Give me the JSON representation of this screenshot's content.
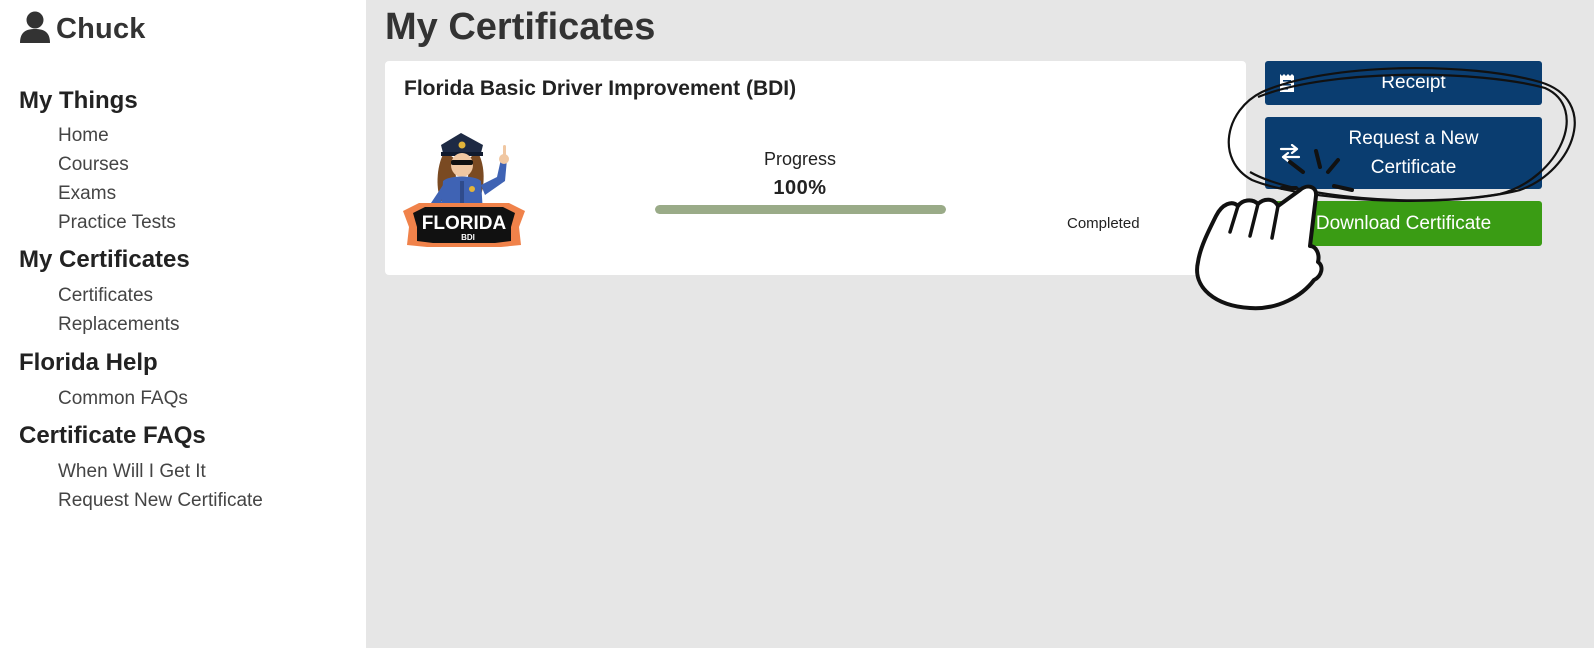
{
  "user": {
    "name": "Chuck",
    "icon": "user-icon"
  },
  "sidebar": {
    "sections": [
      {
        "heading": "My Things",
        "items": [
          "Home",
          "Courses",
          "Exams",
          "Practice Tests"
        ]
      },
      {
        "heading": "My Certificates",
        "items": [
          "Certificates",
          "Replacements"
        ]
      },
      {
        "heading": "Florida Help",
        "items": [
          "Common FAQs"
        ]
      },
      {
        "heading": "Certificate FAQs",
        "items": [
          "When Will I Get It",
          "Request New Certificate"
        ]
      }
    ]
  },
  "main": {
    "title": "My Certificates",
    "card": {
      "course_title": "Florida Basic Driver Improvement (BDI)",
      "logo_text": "FLORIDA",
      "logo_subtext": "BDI",
      "progress_label": "Progress",
      "progress_value": "100%",
      "progress_fraction": 1.0,
      "status": "Completed"
    },
    "actions": {
      "receipt": {
        "label": "Receipt",
        "icon": "receipt-icon"
      },
      "request": {
        "label": "Request a New Certificate",
        "icon": "swap-arrows-icon"
      },
      "download": {
        "label": "Download Certificate"
      }
    }
  },
  "colors": {
    "primary_button": "#0a3d70",
    "download_button": "#3a9c14",
    "progress_fill": "#9aab88",
    "content_background": "#e6e6e6"
  }
}
